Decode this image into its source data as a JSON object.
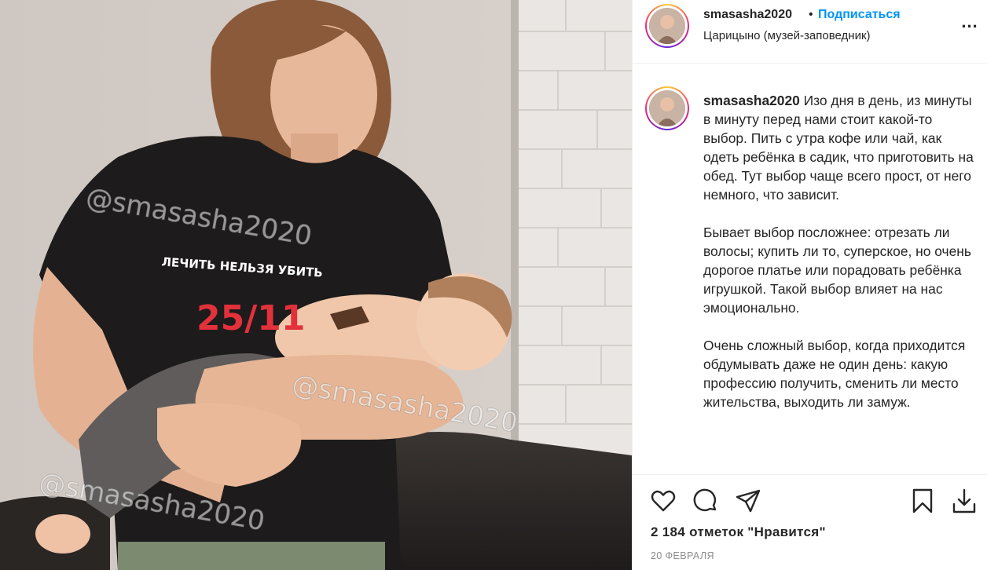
{
  "post": {
    "username": "smasasha2020",
    "dot": "•",
    "follow_label": "Подписаться",
    "location": "Царицыно (музей-заповедник)",
    "more_label": "...",
    "caption_text": " Изо дня в день, из минуты в минуту перед нами стоит какой-то выбор. Пить с утра кофе или чай, как одеть ребёнка в садик, что приготовить на обед. Тут выбор чаще всего прост, от него немного, что зависит.\n\nБывает выбор посложнее: отрезать ли волосы; купить ли то, суперское, но очень дорогое платье или порадовать ребёнка игрушкой. Такой выбор влияет на нас эмоционально.\n\nОчень сложный выбор, когда приходится обдумывать даже не один день: какую профессию получить, сменить ли место жительства, выходить ли замуж.",
    "likes": "2 184 отметок \"Нравится\"",
    "date": "20 ФЕВРАЛЯ"
  },
  "photo": {
    "watermark": "@smasasha2020",
    "shirt_line": "ЛЕЧИТЬ НЕЛЬЗЯ УБИТЬ",
    "shirt_number": "25/11"
  },
  "icons": {
    "like": "heart-icon",
    "comment": "comment-icon",
    "share": "share-icon",
    "save": "bookmark-icon",
    "download": "download-icon"
  },
  "colors": {
    "accent": "#0095f6",
    "text": "#262626",
    "muted": "#8e8e8e",
    "border": "#efefef",
    "shirt_red": "#e2313b"
  }
}
